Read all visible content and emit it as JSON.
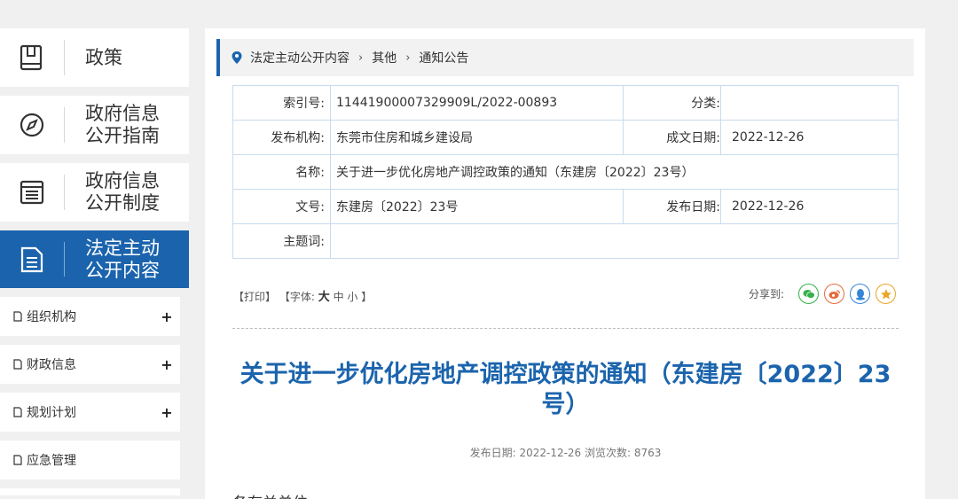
{
  "sidebar": {
    "big_items": [
      {
        "label": "政策",
        "icon": "book-icon"
      },
      {
        "label": "政府信息\n公开指南",
        "icon": "compass-icon"
      },
      {
        "label": "政府信息\n公开制度",
        "icon": "list-icon"
      },
      {
        "label": "法定主动\n公开内容",
        "icon": "document-icon"
      }
    ],
    "small_items": [
      {
        "label": "组织机构",
        "expand": "+"
      },
      {
        "label": "财政信息",
        "expand": "+"
      },
      {
        "label": "规划计划",
        "expand": "+"
      },
      {
        "label": "应急管理",
        "expand": ""
      }
    ],
    "active_color": "#1b64ad"
  },
  "breadcrumb": {
    "items": [
      "法定主动公开内容",
      "其他",
      "通知公告"
    ],
    "separator": "›"
  },
  "meta": {
    "index_label": "索引号:",
    "index_value": "11441900007329909L/2022-00893",
    "category_label": "分类:",
    "category_value": "",
    "publisher_label": "发布机构:",
    "publisher_value": "东莞市住房和城乡建设局",
    "written_date_label": "成文日期:",
    "written_date_value": "2022-12-26",
    "name_label": "名称:",
    "name_value": "关于进一步优化房地产调控政策的通知（东建房〔2022〕23号）",
    "docno_label": "文号:",
    "docno_value": "东建房〔2022〕23号",
    "publish_date_label": "发布日期:",
    "publish_date_value": "2022-12-26",
    "keywords_label": "主题词:",
    "keywords_value": ""
  },
  "tools": {
    "print": "【打印】",
    "font_prefix": "【字体:",
    "font_large": "大",
    "font_medium": "中",
    "font_small": "小",
    "font_suffix": "】"
  },
  "share": {
    "label": "分享到:",
    "buttons": [
      "wechat-icon",
      "weibo-icon",
      "qq-icon",
      "qzone-icon"
    ]
  },
  "article": {
    "title": "关于进一步优化房地产调控政策的通知（东建房〔2022〕23号）",
    "pubinfo": "发布日期: 2022-12-26  浏览次数: 8763",
    "greeting": "各有关单位:"
  }
}
